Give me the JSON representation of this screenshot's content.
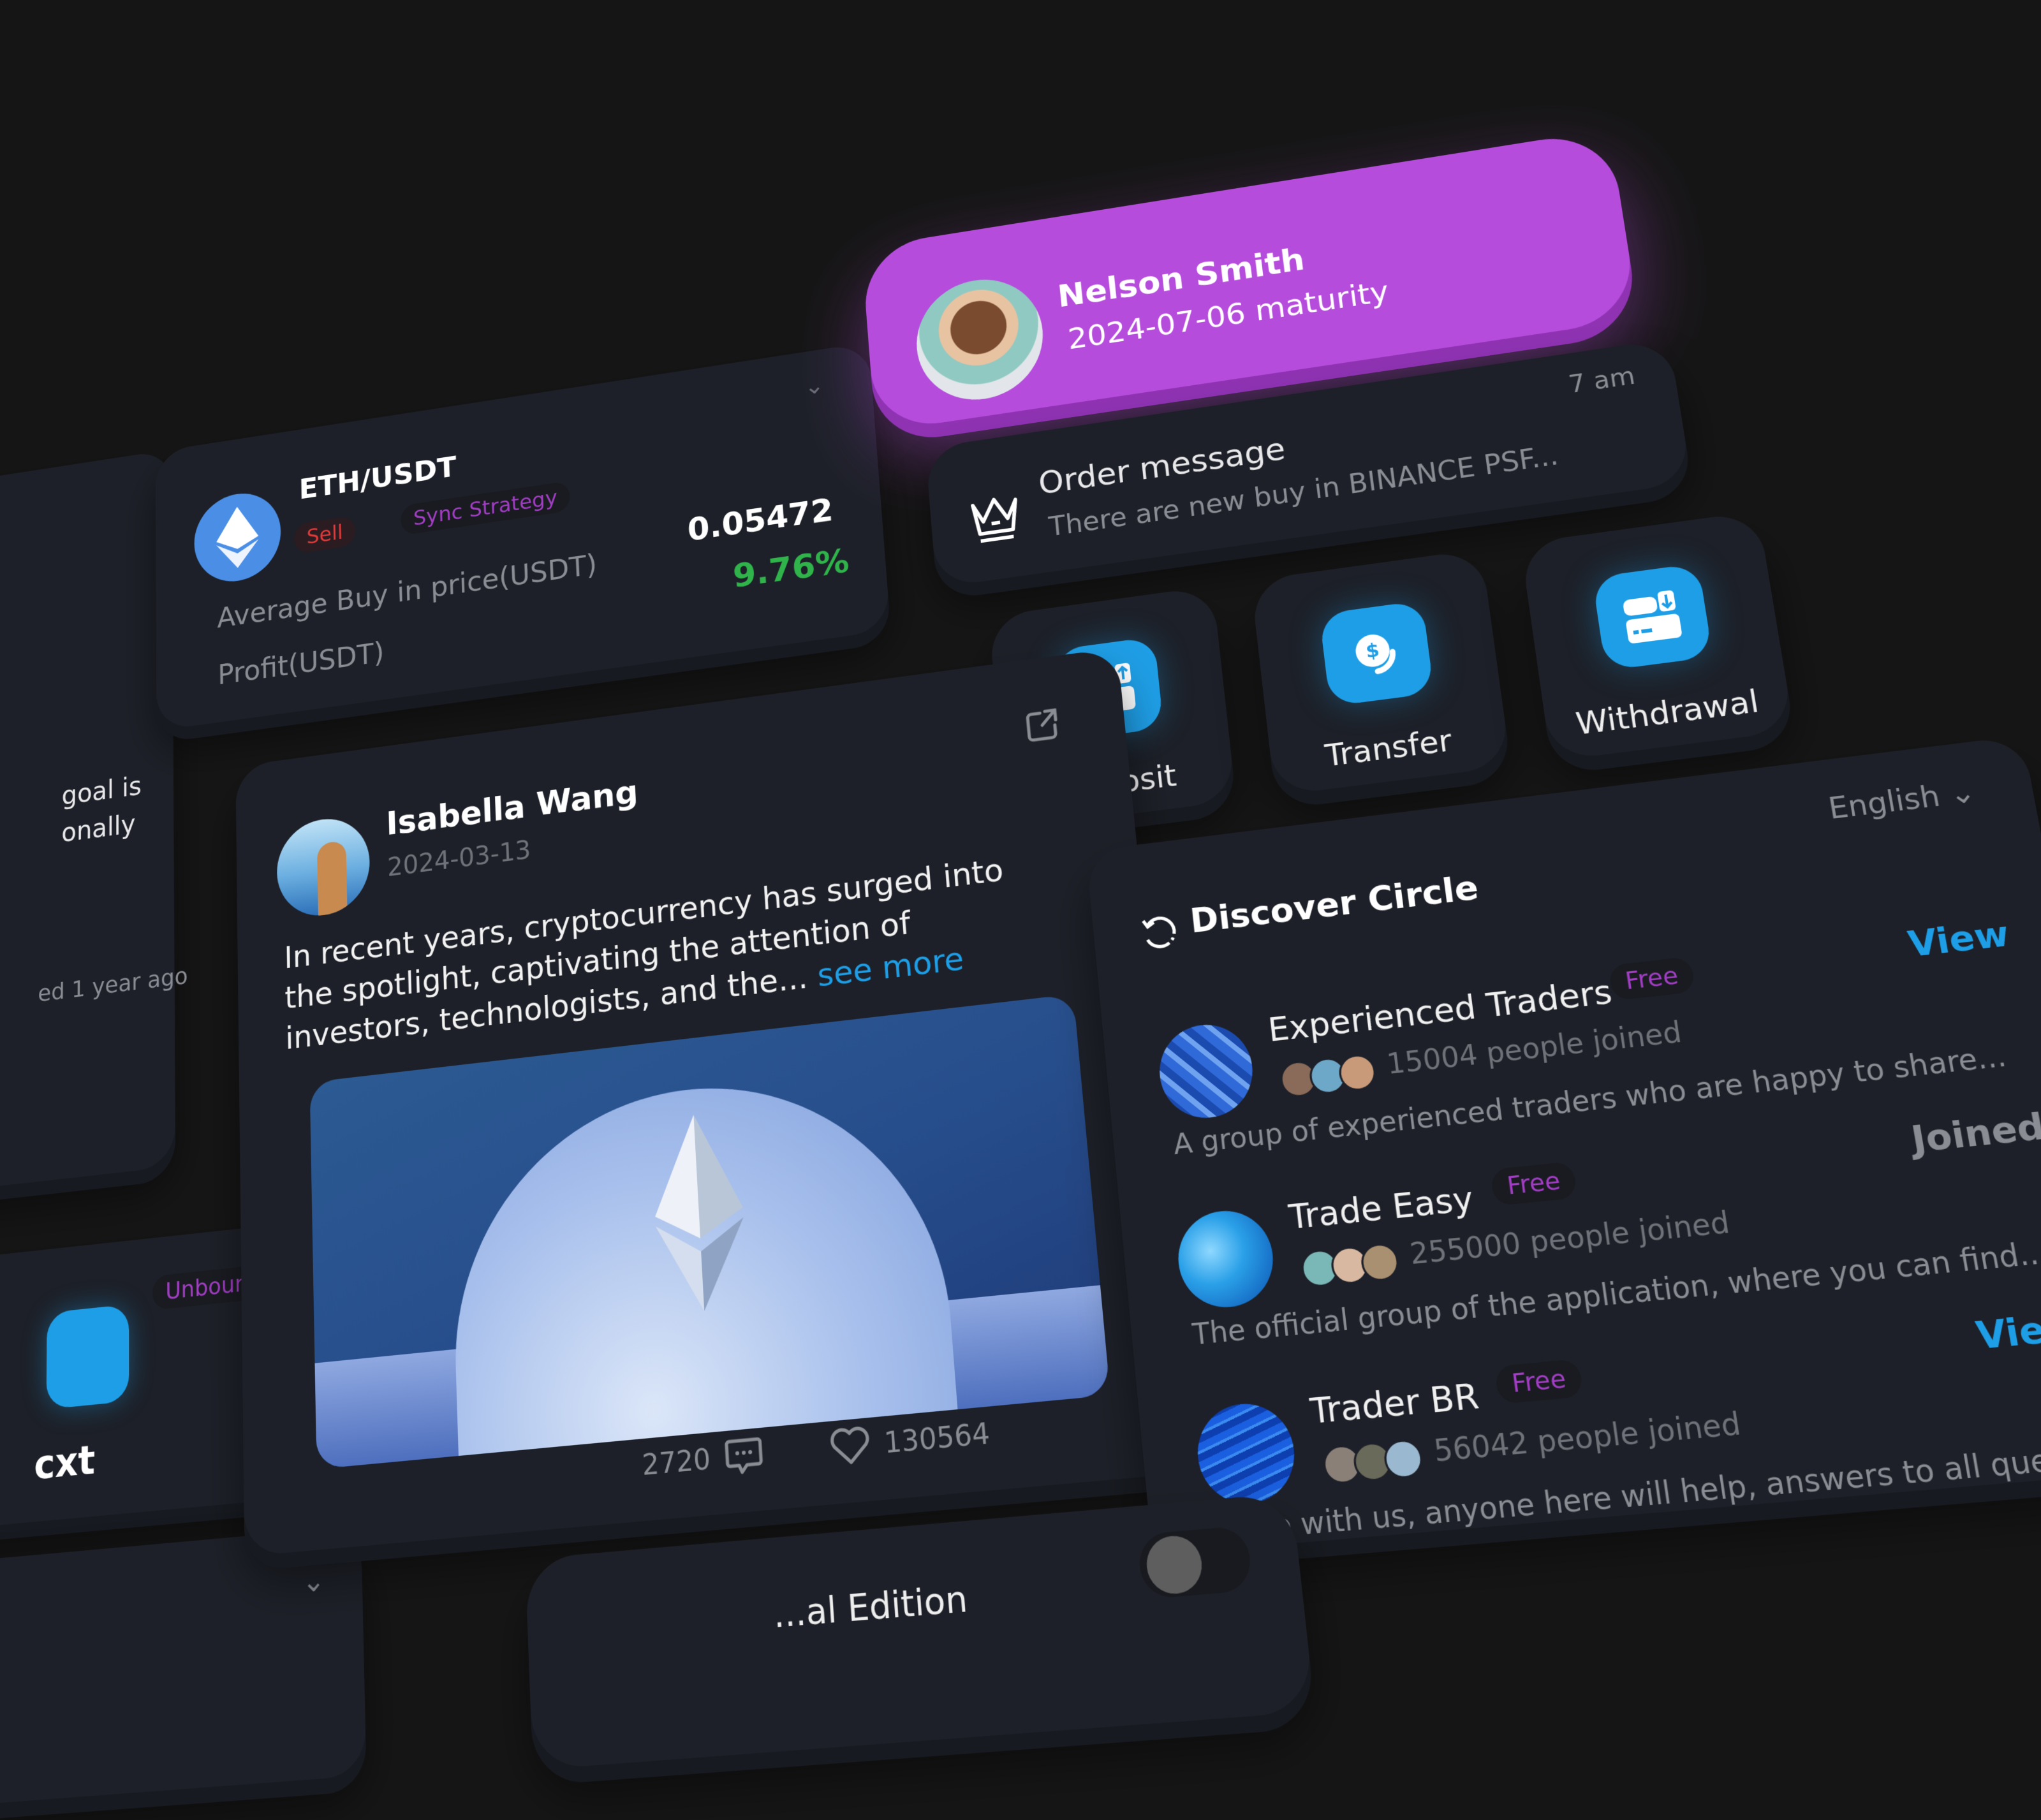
{
  "colors": {
    "background": "#151515",
    "card": "#1d2028",
    "accent_purple": "#b54cdc",
    "accent_blue": "#1e9ee6",
    "profit_green": "#2fb34a",
    "sell_red": "#e03a3a",
    "tag_purple": "#a23ec4"
  },
  "left_column": {
    "top_card": {
      "partial_lines": [
        "goal is",
        "onally"
      ],
      "timestamp": "ed 1 year ago"
    },
    "exchange_card": {
      "badge": "Unbound",
      "name_partial": "cxt"
    }
  },
  "eth_card": {
    "pair": "ETH/USDT",
    "tags": [
      "Sell",
      "Sync Strategy"
    ],
    "avg_label": "Average Buy in price(USDT)",
    "avg_value": "0.05472",
    "profit_label": "Profit(USDT)",
    "profit_value": "9.76%"
  },
  "profile_card": {
    "name": "Nelson Smith",
    "subtitle": "2024-07-06 maturity"
  },
  "order_message": {
    "title": "Order message",
    "body": "There are new buy in BINANCE PSF...",
    "time": "7 am"
  },
  "actions": [
    {
      "label": "Deposit",
      "icon": "wallet-deposit-icon"
    },
    {
      "label": "Transfer",
      "icon": "coin-transfer-icon"
    },
    {
      "label": "Withdrawal",
      "icon": "wallet-withdraw-icon"
    }
  ],
  "post": {
    "author": "Isabella Wang",
    "date": "2024-03-13",
    "body": "In recent years, cryptocurrency has surged into the spotlight, captivating the attention of investors, technologists, and the...",
    "see_more": "see more",
    "comments": "2720",
    "likes": "130564"
  },
  "discover": {
    "title": "Discover Circle",
    "language": "English",
    "groups": [
      {
        "name": "Experienced Traders",
        "tag": "Free",
        "joined": "15004 people joined",
        "desc": "A group of experienced traders who are happy to share...",
        "action": "View"
      },
      {
        "name": "Trade Easy",
        "tag": "Free",
        "joined": "255000 people joined",
        "desc": "The official group of the application, where you can find...",
        "action": "Joined"
      },
      {
        "name": "Trader BR",
        "tag": "Free",
        "joined": "56042 people joined",
        "desc": "Trade with us, anyone here will help, answers to all questi...",
        "action": "View"
      }
    ]
  },
  "edition_row": {
    "label_partial": "...al Edition",
    "toggle_on": false
  }
}
